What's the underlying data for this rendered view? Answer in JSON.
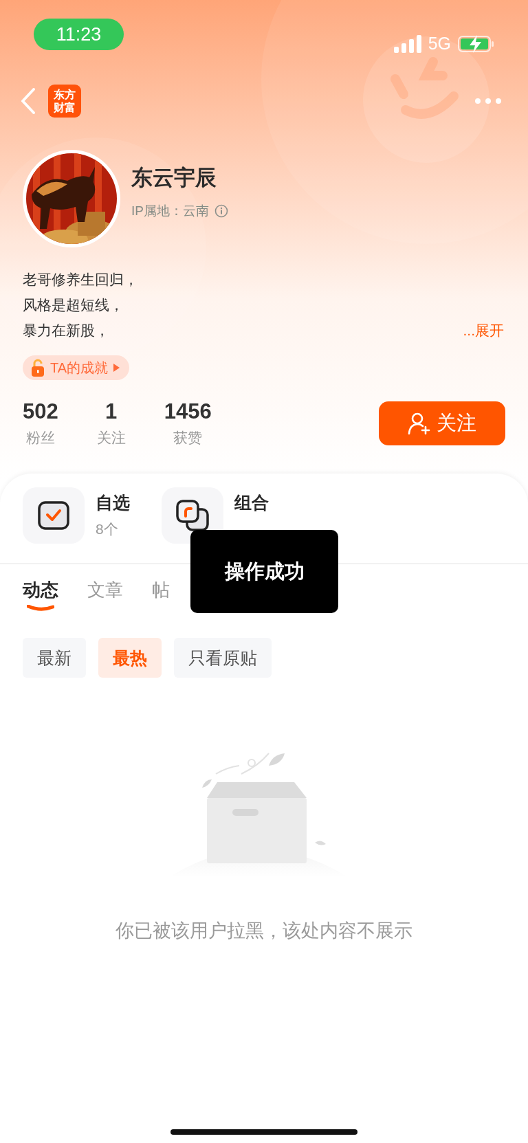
{
  "status_bar": {
    "time": "11:23",
    "network": "5G"
  },
  "header": {
    "app_logo": [
      "东方",
      "财富"
    ]
  },
  "profile": {
    "name": "东云宇辰",
    "ip_location": "IP属地：云南",
    "bio": [
      "老哥修养生回归，",
      "风格是超短线，",
      "暴力在新股，"
    ],
    "expand": "...展开",
    "achievement": "TA的成就",
    "stats": [
      {
        "value": "502",
        "label": "粉丝"
      },
      {
        "value": "1",
        "label": "关注"
      },
      {
        "value": "1456",
        "label": "获赞"
      }
    ],
    "follow_button": "关注"
  },
  "shortcuts": [
    {
      "kind": "watchlist",
      "title": "自选",
      "count": "8个"
    },
    {
      "kind": "portfolio",
      "title": "组合"
    }
  ],
  "tabs": [
    {
      "label": "动态",
      "selected": true
    },
    {
      "label": "文章",
      "selected": false
    },
    {
      "label": "帖",
      "selected": false
    }
  ],
  "filters": [
    {
      "label": "最新",
      "selected": false
    },
    {
      "label": "最热",
      "selected": true
    },
    {
      "label": "只看原贴",
      "selected": false
    }
  ],
  "empty_state": {
    "message": "你已被该用户拉黑，该处内容不展示"
  },
  "toast": "操作成功"
}
